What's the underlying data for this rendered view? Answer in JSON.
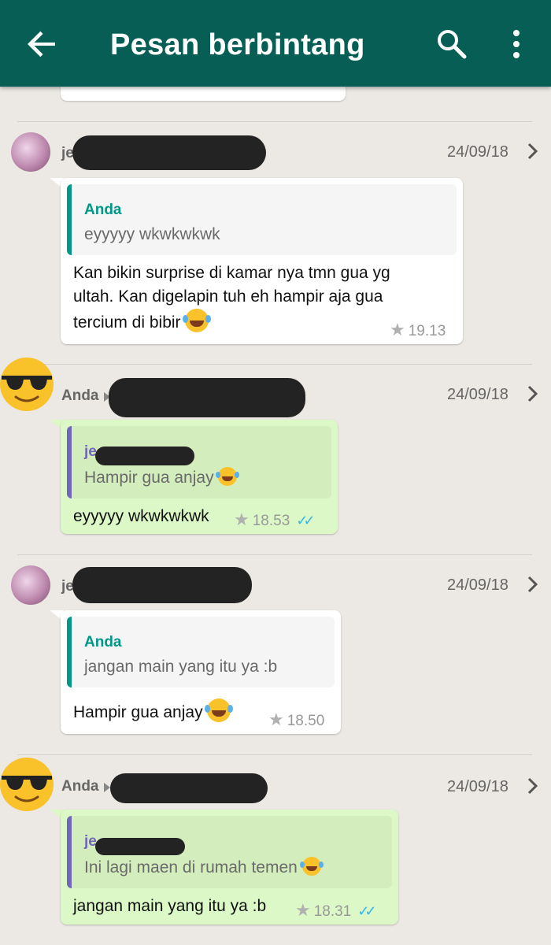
{
  "header": {
    "title": "Pesan berbintang",
    "back_icon": "arrow-back-icon",
    "search_icon": "search-icon",
    "menu_icon": "more-vert-icon",
    "bg_color": "#075e54"
  },
  "messages": [
    {
      "sender": "je",
      "date": "24/09/18",
      "direction": "incoming",
      "quote_name": "Anda",
      "quote_text": "eyyyyy wkwkwkwk",
      "text_lines": [
        "Kan bikin surprise di kamar nya tmn gua yg",
        "ultah. Kan digelapin tuh eh hampir aja gua",
        "tercium di bibir"
      ],
      "time": "19.13"
    },
    {
      "sender": "Anda",
      "date": "24/09/18",
      "direction": "outgoing",
      "quote_name": "je",
      "quote_text": "Hampir gua anjay",
      "text": "eyyyyy wkwkwkwk",
      "time": "18.53"
    },
    {
      "sender": "je",
      "date": "24/09/18",
      "direction": "incoming",
      "quote_name": "Anda",
      "quote_text": "jangan main yang itu ya :b",
      "text": "Hampir gua anjay",
      "time": "18.50"
    },
    {
      "sender": "Anda",
      "date": "24/09/18",
      "direction": "outgoing",
      "quote_name": "je",
      "quote_text": "Ini lagi maen di rumah temen",
      "text": "jangan main yang itu ya :b",
      "time": "18.31"
    }
  ],
  "colors": {
    "accent_teal": "#009688",
    "quote_purple": "#7067b8",
    "outgoing_bubble": "#dcf8c6",
    "read_ticks": "#34b7f1"
  }
}
